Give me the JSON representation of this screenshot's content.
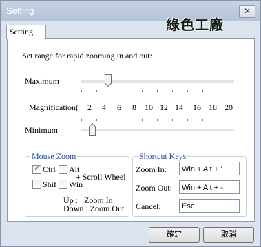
{
  "window": {
    "title": "Setting",
    "close_glyph": "✕"
  },
  "logo": {
    "text": "綠色工廠"
  },
  "tab": {
    "label": "Setting"
  },
  "instructions": "Set range for rapid zooming in and out:",
  "maximum": {
    "label": "Maximum",
    "value_index": 2
  },
  "magnification": {
    "label": "Magnification(",
    "values": [
      "2",
      "4",
      "6",
      "8",
      "10",
      "12",
      "14",
      "16",
      "18",
      "20"
    ]
  },
  "minimum": {
    "label": "Minimum",
    "value_index": 0
  },
  "mouse_zoom": {
    "title": "Mouse Zoom",
    "ctrl": {
      "label": "Ctrl",
      "checked": true
    },
    "alt": {
      "label": "Alt",
      "checked": false
    },
    "shift": {
      "label": "Shif",
      "checked": false
    },
    "win": {
      "label": "Win",
      "checked": false
    },
    "scroll_wheel": "+ Scroll Wheel",
    "up_line": "Up :   Zoom In",
    "down_line": "Down : Zoom Out"
  },
  "shortcut_keys": {
    "title": "Shortcut Keys",
    "zoom_in_label": "Zoom In:",
    "zoom_in_value": "Win + Alt + '",
    "zoom_out_label": "Zoom Out:",
    "zoom_out_value": "Win + Alt + -",
    "cancel_label": "Cancel:",
    "cancel_value": "Esc"
  },
  "buttons": {
    "ok": "確定",
    "cancel": "取消"
  }
}
